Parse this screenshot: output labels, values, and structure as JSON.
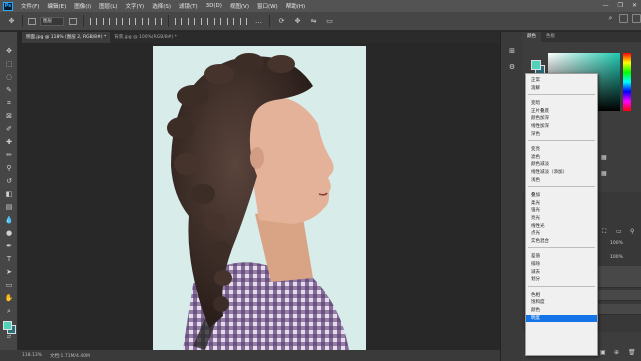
{
  "menubar": {
    "items": [
      "文件(F)",
      "编辑(E)",
      "图像(I)",
      "图层(L)",
      "文字(Y)",
      "选择(S)",
      "滤镜(T)",
      "3D(D)",
      "视图(V)",
      "窗口(W)",
      "帮助(H)"
    ],
    "window_controls": [
      "—",
      "❐",
      "✕"
    ]
  },
  "options": {
    "select_value": "图层"
  },
  "tabs": [
    {
      "label": "侧面.jpg @ 118% (图层 2, RGB/8#) *"
    },
    {
      "label": "背景.jpg @ 100%(RGB/8#) *"
    }
  ],
  "status": {
    "zoom": "118.13%",
    "doc": "文档:1.71M/4.40M"
  },
  "panels": {
    "color_tabs": [
      "颜色",
      "色板"
    ],
    "fg_color": "#4fd2b8",
    "bg_color": "#2d6978",
    "opacity_label": "100%",
    "fill_label": "100%"
  },
  "blend_modes": {
    "groups": [
      [
        "正常",
        "溶解"
      ],
      [
        "变暗",
        "正片叠底",
        "颜色加深",
        "线性加深",
        "深色"
      ],
      [
        "变亮",
        "滤色",
        "颜色减淡",
        "线性减淡（添加）",
        "浅色"
      ],
      [
        "叠加",
        "柔光",
        "强光",
        "亮光",
        "线性光",
        "点光",
        "实色混合"
      ],
      [
        "差值",
        "排除",
        "减去",
        "划分"
      ],
      [
        "色相",
        "饱和度",
        "颜色",
        "明度"
      ]
    ],
    "selected": "明度"
  }
}
